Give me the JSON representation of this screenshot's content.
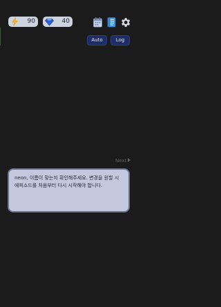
{
  "hud": {
    "energy": {
      "value": "90",
      "icon": "lightning-icon"
    },
    "gems": {
      "value": "40",
      "icon": "gem-icon"
    },
    "icons": [
      "calendar-icon",
      "book-icon",
      "gear-icon"
    ]
  },
  "controls": {
    "auto_label": "Auto",
    "log_label": "Log"
  },
  "next_label": "Next",
  "dialog": {
    "text": "neon, 이름이 맞는지 확인해주세요. 변경을 원할 시 에피소드를 처음부터 다시 시작해야 합니다."
  },
  "colors": {
    "background": "#1b1b1c",
    "pill": "#cfd3de",
    "button": "#1e2d63",
    "dialog_bg": "#c3c8de",
    "dialog_border": "#6d7391"
  }
}
